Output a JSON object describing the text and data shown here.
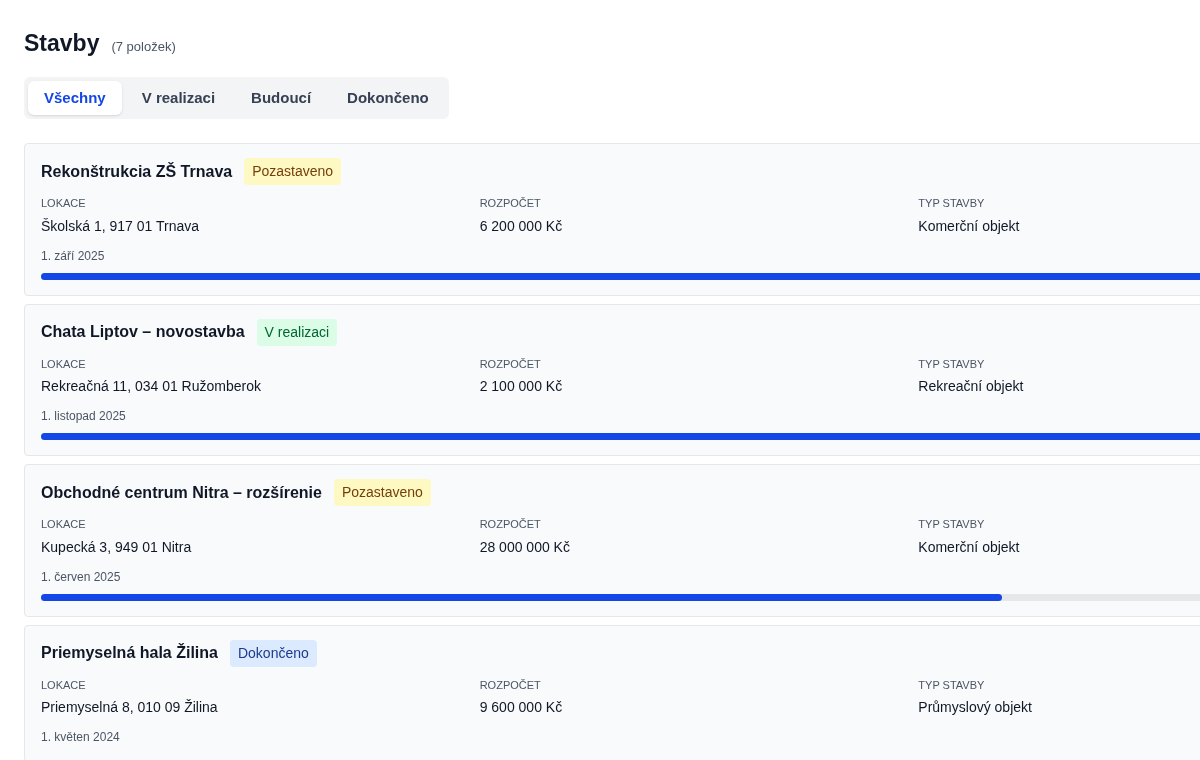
{
  "header": {
    "title": "Stavby",
    "count": "(7 položek)"
  },
  "tabs": [
    {
      "label": "Všechny",
      "selected": true
    },
    {
      "label": "V realizaci",
      "selected": false
    },
    {
      "label": "Budoucí",
      "selected": false
    },
    {
      "label": "Dokončeno",
      "selected": false
    }
  ],
  "projects": [
    {
      "name": "Rekonštrukcia ZŠ Trnava",
      "status": {
        "label": "Pozastaveno",
        "kind": "paused"
      },
      "fields": [
        {
          "label": "LOKACE",
          "value": "Školská 1, 917 01 Trnava"
        },
        {
          "label": "ROZPOČET",
          "value": "6 200 000 Kč"
        },
        {
          "label": "TYP STAVBY",
          "value": "Komerční objekt"
        }
      ],
      "date": "1. září 2025",
      "level": 1
    },
    {
      "name": "Chata Liptov – novostavba",
      "status": {
        "label": "V realizaci",
        "kind": "active"
      },
      "fields": [
        {
          "label": "LOKACE",
          "value": "Rekreačná 11, 034 01 Ružomberok"
        },
        {
          "label": "ROZPOČET",
          "value": "2 100 000 Kč"
        },
        {
          "label": "TYP STAVBY",
          "value": "Rekreační objekt"
        }
      ],
      "date": "1. listopad 2025",
      "level": 1
    },
    {
      "name": "Obchodné centrum Nitra – rozšírenie",
      "status": {
        "label": "Pozastaveno",
        "kind": "paused"
      },
      "fields": [
        {
          "label": "LOKACE",
          "value": "Kupecká 3, 949 01 Nitra"
        },
        {
          "label": "ROZPOČET",
          "value": "28 000 000 Kč"
        },
        {
          "label": "TYP STAVBY",
          "value": "Komerční objekt"
        }
      ],
      "date": "1. červen 2025",
      "level": 0.73
    },
    {
      "name": "Priemyselná hala Žilina",
      "status": {
        "label": "Dokončeno",
        "kind": "done"
      },
      "fields": [
        {
          "label": "LOKACE",
          "value": "Priemyselná 8, 010 09 Žilina"
        },
        {
          "label": "ROZPOČET",
          "value": "9 600 000 Kč"
        },
        {
          "label": "TYP STAVBY",
          "value": "Průmyslový objekt"
        }
      ],
      "date": "1. květen 2024"
    }
  ]
}
